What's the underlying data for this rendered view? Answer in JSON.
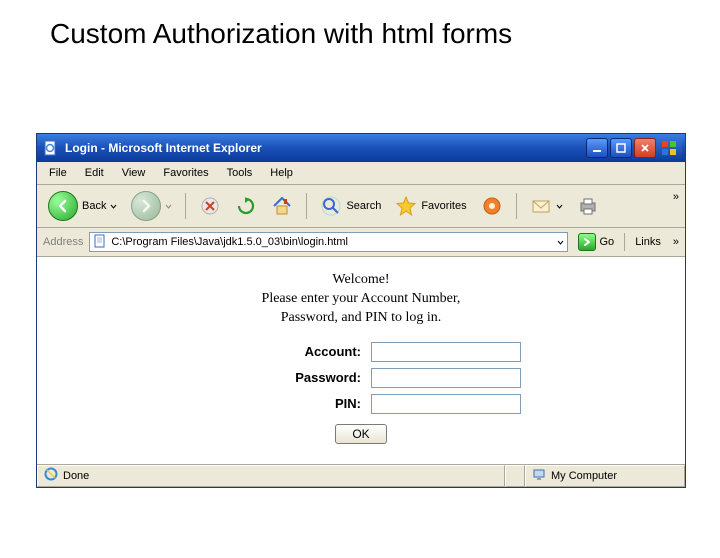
{
  "slide": {
    "title": "Custom Authorization with html forms"
  },
  "window": {
    "title": "Login - Microsoft Internet Explorer",
    "menu": {
      "file": "File",
      "edit": "Edit",
      "view": "View",
      "favorites": "Favorites",
      "tools": "Tools",
      "help": "Help"
    },
    "toolbar": {
      "back": "Back",
      "search": "Search",
      "favorites": "Favorites",
      "overflow": "»"
    },
    "address": {
      "label": "Address",
      "value": "C:\\Program Files\\Java\\jdk1.5.0_03\\bin\\login.html",
      "go": "Go",
      "links": "Links",
      "overflow": "»"
    },
    "status": {
      "done": "Done",
      "zone": "My Computer"
    }
  },
  "page": {
    "welcome_line1": "Welcome!",
    "welcome_line2": "Please enter your Account Number,",
    "welcome_line3": "Password, and PIN to log in.",
    "labels": {
      "account": "Account:",
      "password": "Password:",
      "pin": "PIN:"
    },
    "values": {
      "account": "",
      "password": "",
      "pin": ""
    },
    "submit": "OK"
  }
}
